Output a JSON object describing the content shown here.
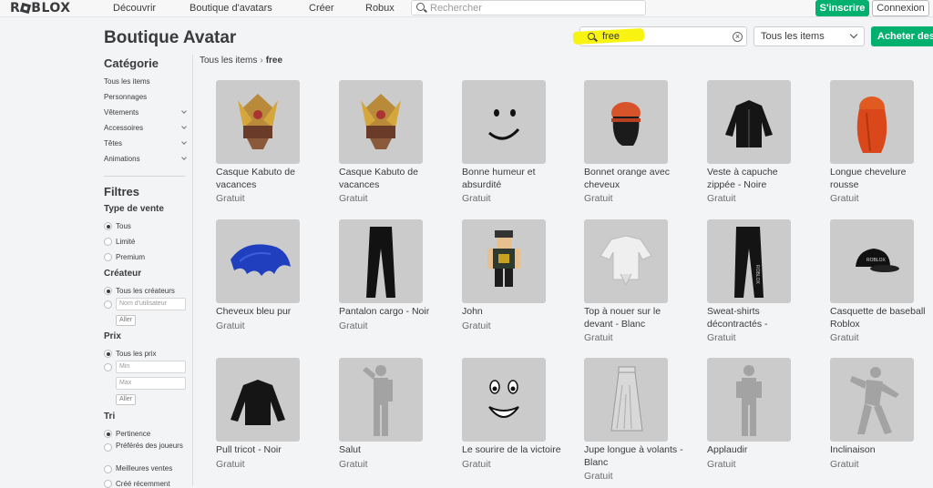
{
  "header": {
    "logo": "ROBLOX",
    "nav": [
      "Découvrir",
      "Boutique d'avatars",
      "Créer",
      "Robux"
    ],
    "search_placeholder": "Rechercher",
    "signup": "S'inscrire",
    "login": "Connexion"
  },
  "page": {
    "title": "Boutique Avatar",
    "search_value": "free",
    "filter_select": "Tous les items",
    "buy_button": "Acheter des Robux",
    "highlight_color": "#f8f311",
    "accent_color": "#00b06f"
  },
  "breadcrumb": {
    "root": "Tous les items",
    "current": "free"
  },
  "sidebar": {
    "category_title": "Catégorie",
    "categories": [
      "Tous les items",
      "Personnages",
      "Vêtements",
      "Accessoires",
      "Têtes",
      "Animations"
    ],
    "filters_title": "Filtres",
    "sale_type_title": "Type de vente",
    "sale_types": [
      "Tous",
      "Limité",
      "Premium"
    ],
    "creator_title": "Créateur",
    "creator_all": "Tous les créateurs",
    "creator_placeholder": "Nom d'utilisateur",
    "go": "Aller",
    "price_title": "Prix",
    "price_all": "Tous les prix",
    "price_min": "Min",
    "price_max": "Max",
    "sort_title": "Tri",
    "sort_options": [
      "Pertinence",
      "Préférés des joueurs",
      "Meilleures ventes",
      "Créé récemment"
    ]
  },
  "items": [
    {
      "name": "Casque Kabuto de vacances",
      "price": "Gratuit",
      "icon": "kabuto-helmet-icon"
    },
    {
      "name": "Casque Kabuto de vacances",
      "price": "Gratuit",
      "icon": "kabuto-helmet-icon"
    },
    {
      "name": "Bonne humeur et absurdité",
      "price": "Gratuit",
      "icon": "smile-face-icon"
    },
    {
      "name": "Bonnet orange avec cheveux",
      "price": "Gratuit",
      "icon": "beanie-hair-icon"
    },
    {
      "name": "Veste à capuche zippée - Noire",
      "price": "Gratuit",
      "icon": "hoodie-icon"
    },
    {
      "name": "Longue chevelure rousse",
      "price": "Gratuit",
      "icon": "red-hair-icon"
    },
    {
      "name": "Cheveux bleu pur",
      "price": "Gratuit",
      "icon": "blue-hair-icon"
    },
    {
      "name": "Pantalon cargo - Noir",
      "price": "Gratuit",
      "icon": "pants-icon"
    },
    {
      "name": "John",
      "price": "Gratuit",
      "icon": "avatar-figure-icon"
    },
    {
      "name": "Top à nouer sur le devant - Blanc",
      "price": "Gratuit",
      "icon": "tie-top-icon"
    },
    {
      "name": "Sweat-shirts décontractés -",
      "price": "Gratuit",
      "icon": "sweatpants-icon"
    },
    {
      "name": "Casquette de baseball Roblox",
      "price": "Gratuit",
      "icon": "cap-icon"
    },
    {
      "name": "Pull tricot - Noir",
      "price": "Gratuit",
      "icon": "sweater-icon"
    },
    {
      "name": "Salut",
      "price": "Gratuit",
      "icon": "salute-emote-icon"
    },
    {
      "name": "Le sourire de la victoire",
      "price": "Gratuit",
      "icon": "grin-face-icon"
    },
    {
      "name": "Jupe longue à volants - Blanc",
      "price": "Gratuit",
      "icon": "skirt-icon"
    },
    {
      "name": "Applaudir",
      "price": "Gratuit",
      "icon": "clap-emote-icon"
    },
    {
      "name": "Inclinaison",
      "price": "Gratuit",
      "icon": "tilt-emote-icon"
    }
  ]
}
